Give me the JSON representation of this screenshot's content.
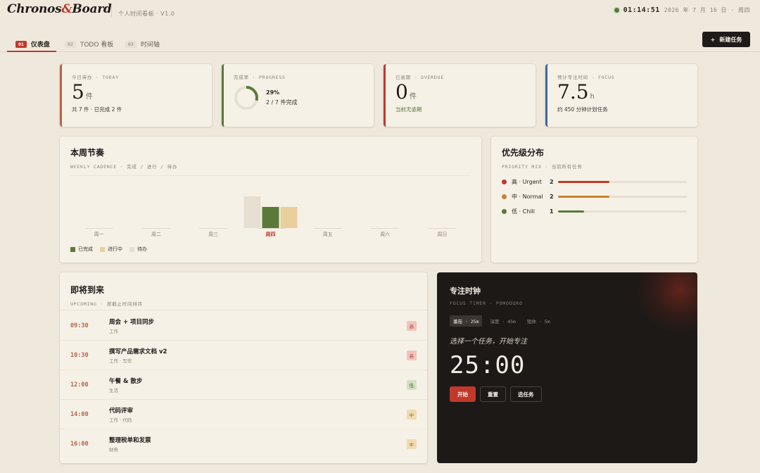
{
  "header": {
    "logo_left": "Chronos",
    "logo_amp": "&",
    "logo_right": "Board",
    "subtitle": "个人时间看板 · V1.0",
    "time": "01:14:51",
    "date": "2026 年 7 月 16 日 · 周四"
  },
  "nav": {
    "tabs": [
      {
        "num": "01",
        "label": "仪表盘"
      },
      {
        "num": "02",
        "label": "TODO 看板"
      },
      {
        "num": "03",
        "label": "时间轴"
      }
    ],
    "new_task_icon": "+",
    "new_task_label": "新建任务"
  },
  "stats": [
    {
      "label": "今日待办 · TODAY",
      "value": "5",
      "unit": "件",
      "note": "共 7 件 · 已完成 2 件",
      "color": "#b5654a"
    },
    {
      "label": "完成率 · PROGRESS",
      "percent": "29%",
      "detail": "2 / 7 件完成",
      "progress": 0.29,
      "color": "#5a7a3a"
    },
    {
      "label": "已逾期 · OVERDUE",
      "value": "0",
      "unit": "件",
      "note": "当前无逾期",
      "color": "#c0392b"
    },
    {
      "label": "预计专注时间 · FOCUS",
      "value": "7.5",
      "unit": "h",
      "note": "约 450 分钟计划任务",
      "color": "#3a6a9a"
    }
  ],
  "weekly": {
    "title": "本周节奏",
    "subtitle": "WEEKLY CADENCE · 完成 / 进行 / 待办",
    "legend": [
      {
        "label": "已完成",
        "color": "#5a7a3a"
      },
      {
        "label": "进行中",
        "color": "#e8cf9c"
      },
      {
        "label": "待办",
        "color": "#e6dfd2"
      }
    ]
  },
  "chart_data": {
    "type": "bar",
    "categories": [
      "周一",
      "周二",
      "周三",
      "周四",
      "周五",
      "周六",
      "周日"
    ],
    "series": [
      {
        "name": "待办",
        "values": [
          0,
          0,
          0,
          3,
          0,
          0,
          0
        ],
        "color": "#e6dfd2"
      },
      {
        "name": "已完成",
        "values": [
          0,
          0,
          0,
          2,
          0,
          0,
          0
        ],
        "color": "#5a7a3a"
      },
      {
        "name": "进行中",
        "values": [
          0,
          0,
          0,
          2,
          0,
          0,
          0
        ],
        "color": "#e8cf9c"
      }
    ],
    "highlight": "周四",
    "ylim": [
      0,
      3
    ]
  },
  "priority": {
    "title": "优先级分布",
    "subtitle": "PRIORITY MIX · 当前所有任务",
    "rows": [
      {
        "label": "高 · Urgent",
        "count": "2",
        "fraction": 0.4,
        "color": "#c0392b"
      },
      {
        "label": "中 · Normal",
        "count": "2",
        "fraction": 0.4,
        "color": "#c9822a"
      },
      {
        "label": "低 · Chill",
        "count": "1",
        "fraction": 0.2,
        "color": "#5a7a3a"
      }
    ]
  },
  "upcoming": {
    "title": "即将到来",
    "subtitle": "UPCOMING · 按截止时间排序",
    "items": [
      {
        "time": "09:30",
        "name": "周会 + 项目同步",
        "sub": "工作",
        "badge": "高",
        "badge_bg": "#f0c4bd",
        "badge_fg": "#b03a2e"
      },
      {
        "time": "10:30",
        "name": "撰写产品需求文档 v2",
        "sub": "工作 · 写作",
        "badge": "高",
        "badge_bg": "#f0c4bd",
        "badge_fg": "#b03a2e"
      },
      {
        "time": "12:00",
        "name": "午餐 & 散步",
        "sub": "生活",
        "badge": "低",
        "badge_bg": "#d4e0c3",
        "badge_fg": "#4a6a2e"
      },
      {
        "time": "14:00",
        "name": "代码评审",
        "sub": "工作 · 代码",
        "badge": "中",
        "badge_bg": "#f1dbb0",
        "badge_fg": "#9a6a1e"
      },
      {
        "time": "16:00",
        "name": "整理税单和发票",
        "sub": "财务",
        "badge": "中",
        "badge_bg": "#f1dbb0",
        "badge_fg": "#9a6a1e"
      }
    ]
  },
  "focus": {
    "title": "专注时钟",
    "subtitle": "FOCUS TIMER · POMODORO",
    "modes": [
      "番茄 · 25m",
      "深度 · 45m",
      "短休 · 5m"
    ],
    "prompt": "选择一个任务，开始专注",
    "timer": "25:00",
    "buttons": {
      "start": "开始",
      "reset": "重置",
      "pick": "选任务"
    }
  }
}
